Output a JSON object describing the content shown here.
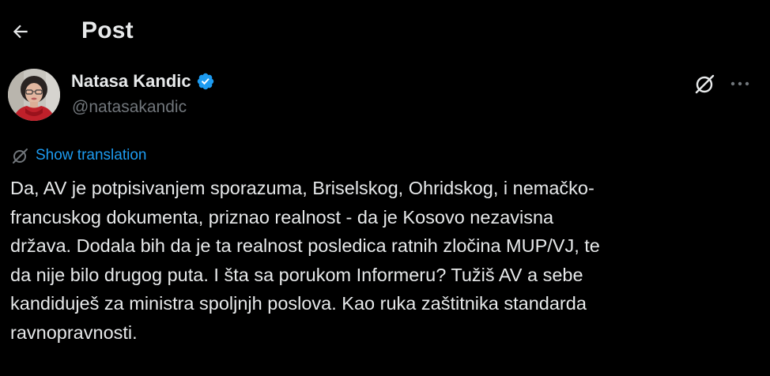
{
  "header": {
    "title": "Post",
    "back_icon": "arrow-left-icon"
  },
  "author": {
    "display_name": "Natasa Kandic",
    "handle": "@natasakandic",
    "verified_icon": "verified-badge-icon",
    "verified_color": "#1d9bf0"
  },
  "actions": {
    "grok_icon": "grok-icon",
    "more_icon": "more-horizontal-icon"
  },
  "translation": {
    "label": "Show translation",
    "icon": "translate-icon",
    "color": "#1d9bf0"
  },
  "tweet": {
    "text": "Da, AV je potpisivanjem sporazuma, Briselskog, Ohridskog, i nemačko-\nfrancuskog dokumenta, priznao realnost - da je Kosovo nezavisna\ndržava. Dodala bih da je ta realnost posledica ratnih zločina MUP/VJ, te\nda nije bilo drugog puta. I šta sa porukom Informeru? Tužiš AV a sebe\nkandiduješ za ministra spoljnjh poslova. Kao ruka zaštitnika standarda\nravnopravnosti."
  },
  "colors": {
    "background": "#000000",
    "text_primary": "#e7e9ea",
    "text_secondary": "#71767b",
    "accent": "#1d9bf0"
  }
}
